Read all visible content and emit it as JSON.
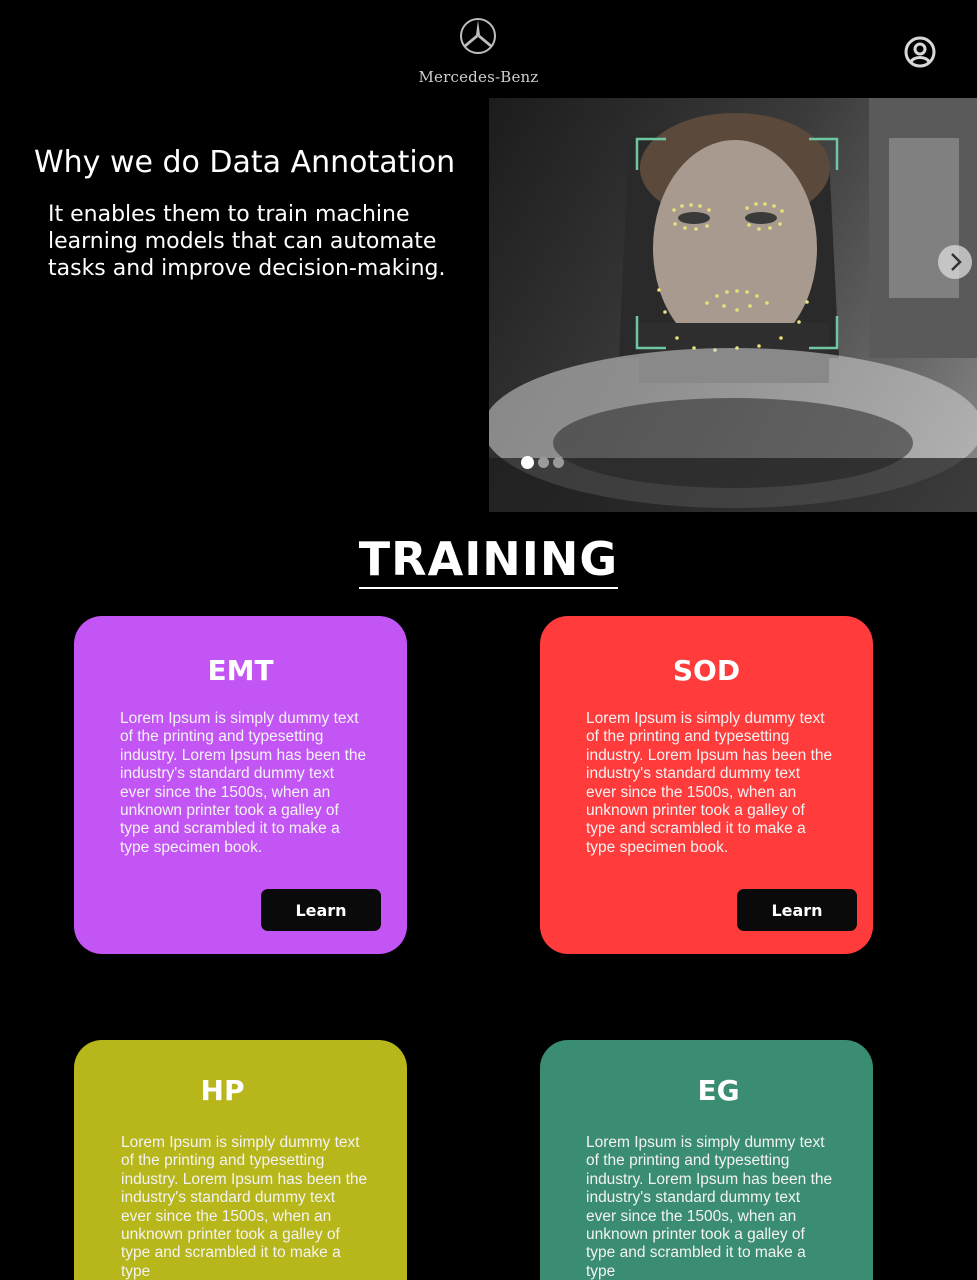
{
  "header": {
    "brand_name": "Mercedes-Benz",
    "logo_icon": "mercedes-star-icon",
    "account_icon": "user-account-icon"
  },
  "hero": {
    "title": "Why we do Data Annotation",
    "body": "It enables them to train machine learning models that can automate tasks and improve decision-making.",
    "next_icon": "chevron-right-icon",
    "slides_total": 3,
    "active_slide": 1
  },
  "training": {
    "title": "TRAINING",
    "cards": [
      {
        "title": "EMT",
        "body": "Lorem Ipsum is simply dummy text of the printing and typesetting industry. Lorem Ipsum has been the industry's standard dummy text ever since the 1500s, when an unknown printer took a galley of type and scrambled it to make a type specimen book.",
        "button": "Learn",
        "color": "#c355f5"
      },
      {
        "title": "SOD",
        "body": "Lorem Ipsum is simply dummy text of the printing and typesetting industry. Lorem Ipsum has been the industry's standard dummy text ever since the 1500s, when an unknown printer took a galley of type and scrambled it to make a type specimen book.",
        "button": "Learn",
        "color": "#ff3b3b"
      },
      {
        "title": "HP",
        "body": "Lorem Ipsum is simply dummy text of the printing and typesetting industry. Lorem Ipsum has been the industry's standard dummy text ever since the 1500s, when an unknown printer took a galley of type and scrambled it to make a type",
        "color": "#b7b61a"
      },
      {
        "title": "EG",
        "body": "Lorem Ipsum is simply dummy text of the printing and typesetting industry. Lorem Ipsum has been the industry's standard dummy text ever since the 1500s, when an unknown printer took a galley of type and scrambled it to make a type",
        "color": "#3a8c72"
      }
    ]
  }
}
